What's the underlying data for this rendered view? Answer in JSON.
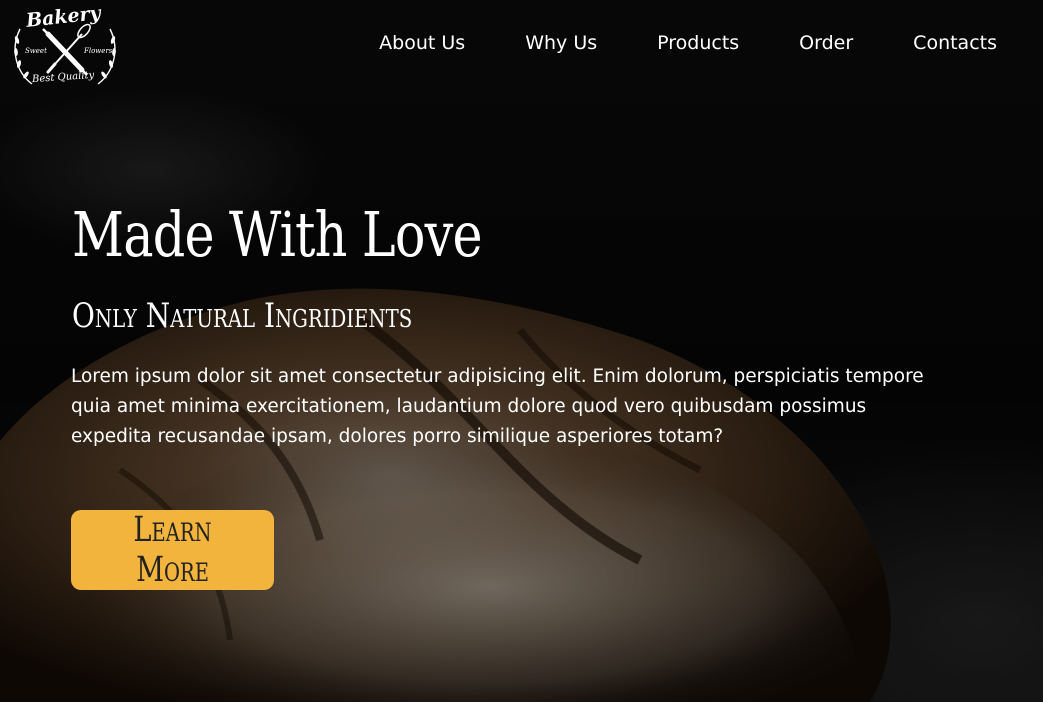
{
  "logo": {
    "title": "Bakery",
    "left_text": "Sweet",
    "right_text": "Flowers",
    "bottom_text": "Best Quality",
    "icon": "crossed-rolling-pin-whisk-icon"
  },
  "nav": {
    "items": [
      {
        "label": "About Us"
      },
      {
        "label": "Why Us"
      },
      {
        "label": "Products"
      },
      {
        "label": "Order"
      },
      {
        "label": "Contacts"
      }
    ]
  },
  "hero": {
    "title": "Made With Love",
    "subtitle": "Only Natural Ingridients",
    "text": "Lorem ipsum dolor sit amet consectetur adipisicing elit. Enim dolorum, perspiciatis tempore quia amet minima exercitationem, laudantium dolore quod vero quibusdam possimus expedita recusandae ipsam, dolores porro similique asperiores totam?",
    "cta_label": "Learn More",
    "background": "bread-loaf-photo"
  },
  "colors": {
    "accent": "#f2b43c",
    "header_bg": "#080808",
    "text": "#ffffff"
  }
}
